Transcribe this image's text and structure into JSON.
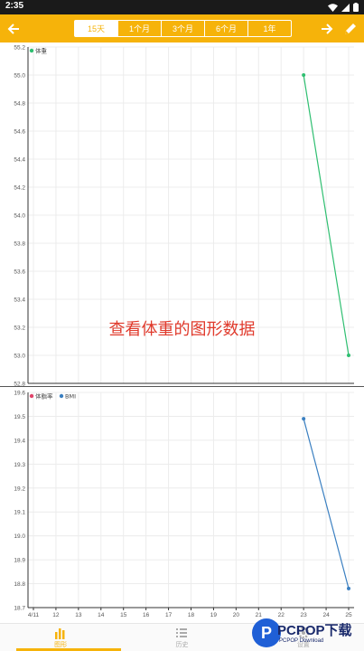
{
  "status_bar": {
    "time": "2:35"
  },
  "header": {
    "tabs": [
      {
        "label": "15天",
        "active": true
      },
      {
        "label": "1个月",
        "active": false
      },
      {
        "label": "3个月",
        "active": false
      },
      {
        "label": "6个月",
        "active": false
      },
      {
        "label": "1年",
        "active": false
      }
    ],
    "accent_color": "#f6b30a"
  },
  "caption": "查看体重的图形数据",
  "x_tick_labels": [
    "4/11",
    "12",
    "13",
    "14",
    "15",
    "16",
    "17",
    "18",
    "19",
    "20",
    "21",
    "22",
    "23",
    "24",
    "25"
  ],
  "chart_data": [
    {
      "type": "line",
      "legend": [
        "体重"
      ],
      "series": [
        {
          "name": "体重",
          "color": "#2fbf71",
          "x": [
            "23",
            "25"
          ],
          "values": [
            55.0,
            53.0
          ]
        }
      ],
      "ylim": [
        52.8,
        55.2
      ],
      "yticks": [
        "55.2",
        "55.0",
        "54.8",
        "54.6",
        "54.4",
        "54.2",
        "54.0",
        "53.8",
        "53.6",
        "53.4",
        "53.2",
        "53.0",
        "52.8"
      ],
      "grid": true,
      "legend_position": "top-left"
    },
    {
      "type": "line",
      "legend": [
        "体脂率",
        "BMI"
      ],
      "legend_colors": [
        "#e0446a",
        "#3a7fc1"
      ],
      "series": [
        {
          "name": "体脂率",
          "color": "#e0446a",
          "x": [],
          "values": []
        },
        {
          "name": "BMI",
          "color": "#3a7fc1",
          "x": [
            "23",
            "25"
          ],
          "values": [
            19.49,
            18.78
          ]
        }
      ],
      "ylim": [
        18.7,
        19.6
      ],
      "yticks": [
        "19.6",
        "19.5",
        "19.4",
        "19.3",
        "19.2",
        "19.1",
        "19.0",
        "18.9",
        "18.8",
        "18.7"
      ],
      "grid": true,
      "legend_position": "top-left"
    }
  ],
  "bottom_nav": [
    {
      "label": "图形",
      "icon": "bar-chart-icon",
      "active": true
    },
    {
      "label": "历史",
      "icon": "list-icon",
      "active": false
    },
    {
      "label": "设置",
      "icon": "gear-icon",
      "active": false
    }
  ],
  "watermark": {
    "logo_letter": "P",
    "text": "PCPOP下载",
    "sub": "PCPOP Download"
  }
}
